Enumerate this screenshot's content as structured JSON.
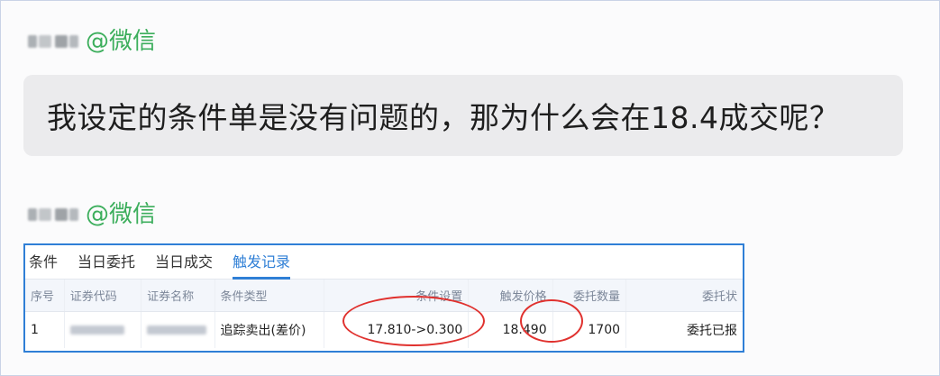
{
  "messages": [
    {
      "sender_tag": "@微信"
    },
    {
      "sender_tag": "@微信"
    }
  ],
  "bubble": {
    "text": "我设定的条件单是没有问题的，那为什么会在18.4成交呢？"
  },
  "panel": {
    "tabs": [
      {
        "label": "条件",
        "active": false
      },
      {
        "label": "当日委托",
        "active": false
      },
      {
        "label": "当日成交",
        "active": false
      },
      {
        "label": "触发记录",
        "active": true
      }
    ],
    "columns": [
      "序号",
      "证券代码",
      "证券名称",
      "条件类型",
      "条件设置",
      "触发价格",
      "委托数量",
      "委托状"
    ],
    "rows": [
      {
        "index": "1",
        "condition_type": "追踪卖出(差价)",
        "condition_setting": "17.810->0.300",
        "trigger_price": "18.490",
        "quantity": "1700",
        "status": "委托已报"
      }
    ]
  },
  "colors": {
    "accent": "#2f7fd6",
    "wechat_green": "#3cae5c",
    "highlight_ring": "#e0312e"
  }
}
